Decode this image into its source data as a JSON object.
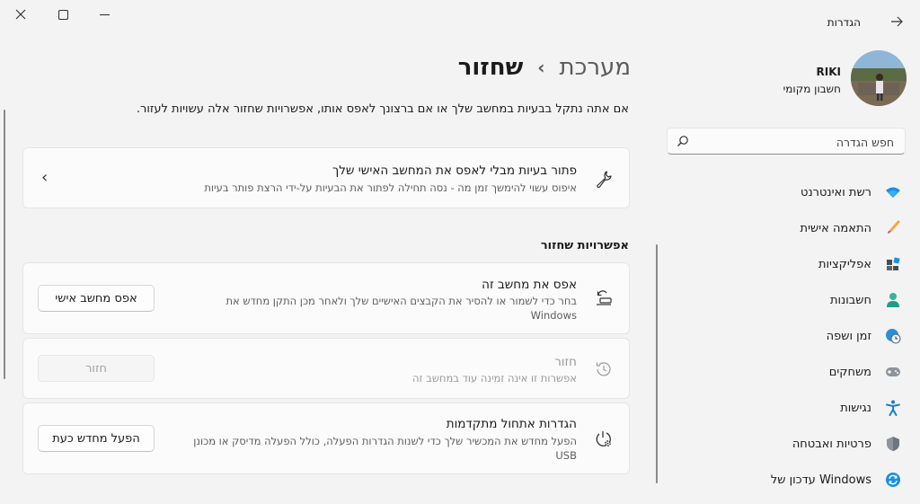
{
  "window": {
    "title": "הגדרות",
    "controls": {
      "close": "✕",
      "maximize": "☐",
      "minimize": "—"
    }
  },
  "profile": {
    "name": "RIKI",
    "account_type": "חשבון מקומי"
  },
  "search": {
    "placeholder": "חפש הגדרה"
  },
  "nav": {
    "items": [
      {
        "label": "רשת ואינטרנט",
        "icon": "wifi-icon"
      },
      {
        "label": "התאמה אישית",
        "icon": "brush-icon"
      },
      {
        "label": "אפליקציות",
        "icon": "apps-icon"
      },
      {
        "label": "חשבונות",
        "icon": "person-icon"
      },
      {
        "label": "זמן ושפה",
        "icon": "globe-clock-icon"
      },
      {
        "label": "משחקים",
        "icon": "gamepad-icon"
      },
      {
        "label": "נגישות",
        "icon": "accessibility-icon"
      },
      {
        "label": "פרטיות ואבטחה",
        "icon": "shield-icon"
      },
      {
        "label": "עדכון של Windows",
        "icon": "update-icon"
      }
    ]
  },
  "breadcrumb": {
    "parent": "מערכת",
    "separator": "›",
    "current": "שחזור"
  },
  "description": "אם אתה נתקל בבעיות במחשב שלך או אם ברצונך לאפס אותו, אפשרויות שחזור אלה עשויות לעזור.",
  "troubleshoot_card": {
    "title": "פתור בעיות מבלי לאפס את המחשב האישי שלך",
    "subtitle": "איפוס עשוי להימשך זמן מה - נסה תחילה לפתור את הבעיות על-ידי הרצת פותר בעיות",
    "chevron": "›"
  },
  "recovery_section": {
    "heading": "אפשרויות שחזור",
    "reset": {
      "title": "אפס את מחשב זה",
      "subtitle_line1": "בחר כדי לשמור או להסיר את הקבצים האישיים שלך ולאחר מכן התקן מחדש את",
      "subtitle_line2": "Windows",
      "button": "אפס מחשב אישי"
    },
    "go_back": {
      "title": "חזור",
      "subtitle": "אפשרות זו אינה זמינה עוד במחשב זה",
      "button": "חזור"
    },
    "advanced_startup": {
      "title": "הגדרות אתחול מתקדמות",
      "subtitle_line1": "הפעל מחדש את המכשיר שלך כדי לשנות הגדרות הפעלה, כולל הפעלה מדיסק או מכונן",
      "subtitle_line2": "USB",
      "button": "הפעל מחדש כעת"
    }
  },
  "colors": {
    "background": "#f3f3f3",
    "card": "#fbfbfb",
    "accent": "#0067c0"
  }
}
